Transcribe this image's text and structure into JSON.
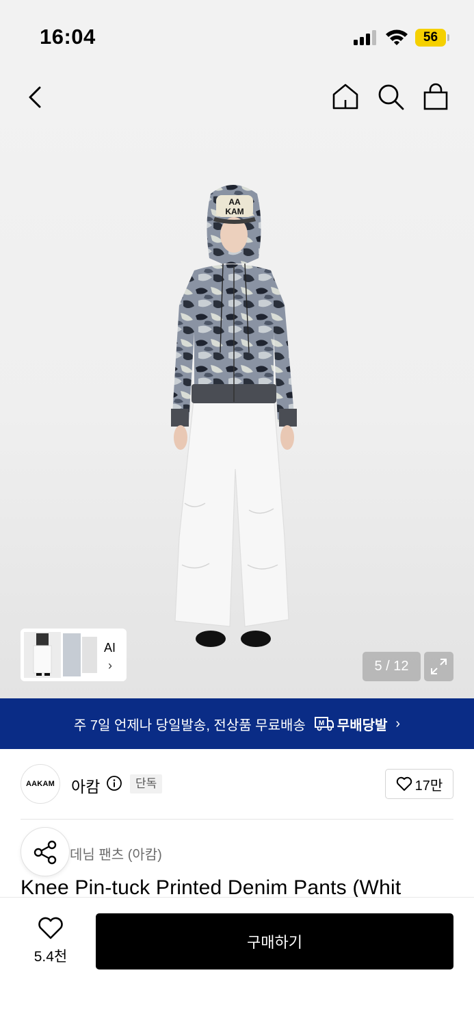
{
  "status_bar": {
    "time": "16:04",
    "battery": "56"
  },
  "gallery": {
    "counter": "5 / 12",
    "thumbnail_label": "AI",
    "thumbnail_chevron": "›"
  },
  "banner": {
    "text": "주 7일 언제나 당일발송, 전상품 무료배송",
    "brand": "무배당발",
    "chevron": "›"
  },
  "brand": {
    "logo_text": "AAKAM",
    "name": "아캄",
    "badge": "단독",
    "likes": "17만"
  },
  "product": {
    "category": "데님 팬츠 (아캄)",
    "title": "Knee Pin-tuck Printed Denim Pants (Whit"
  },
  "bottom": {
    "wish_count": "5.4천",
    "buy_label": "구매하기"
  },
  "icons": [
    "back-icon",
    "home-icon",
    "search-icon",
    "bag-icon",
    "expand-icon",
    "info-icon",
    "heart-icon",
    "share-icon",
    "truck-icon"
  ],
  "colors": {
    "banner": "#0a2c86",
    "buy_button": "#000000",
    "battery": "#f5d000"
  }
}
